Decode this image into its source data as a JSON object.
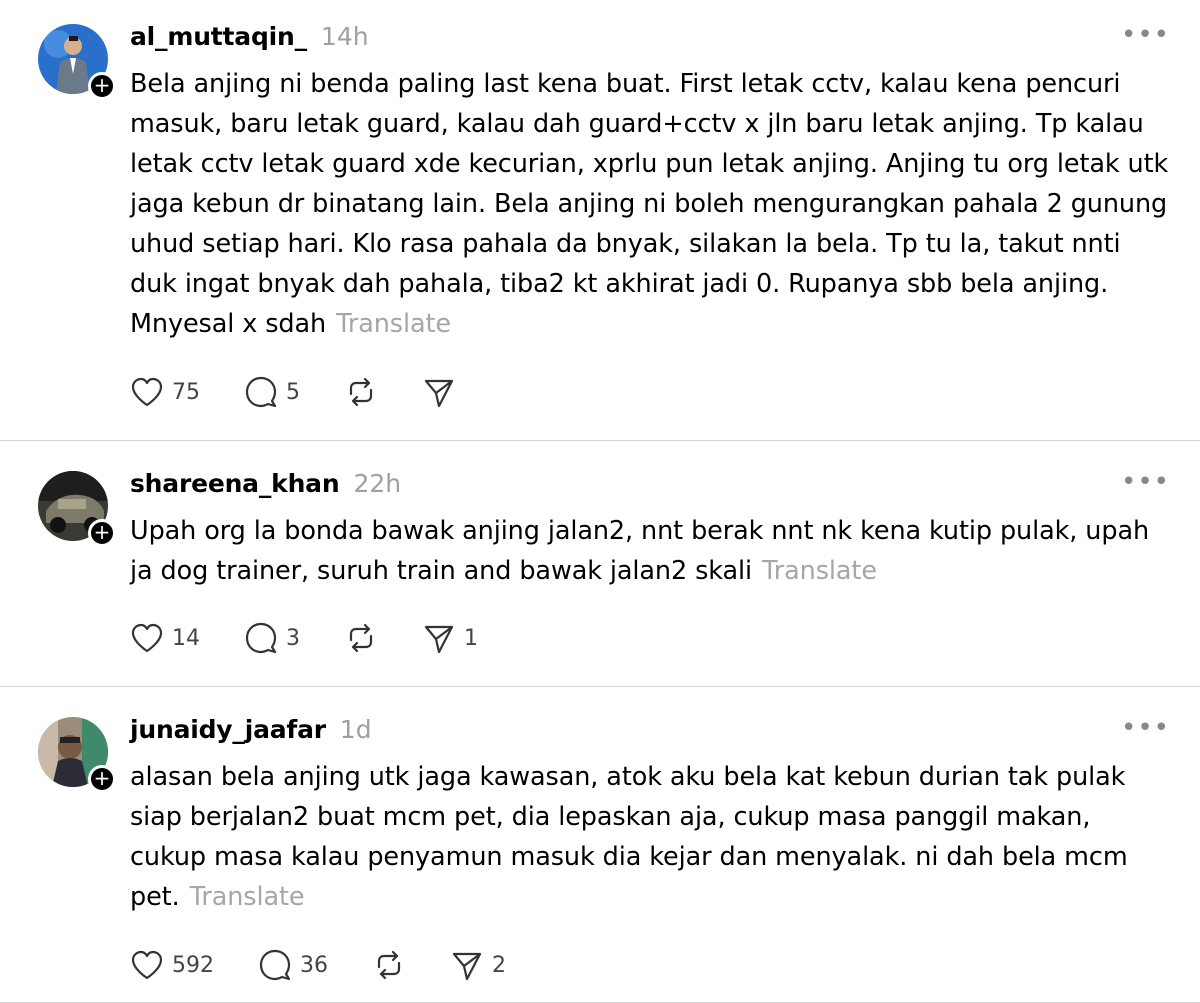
{
  "posts": [
    {
      "username": "al_muttaqin_",
      "time": "14h",
      "text": "Bela anjing ni benda paling last kena buat. First letak cctv, kalau kena pencuri masuk, baru letak guard, kalau dah guard+cctv x jln baru letak anjing. Tp kalau letak cctv letak guard xde kecurian, xprlu pun letak anjing. Anjing tu org letak utk jaga kebun dr binatang lain. Bela anjing ni boleh mengurangkan pahala 2 gunung uhud setiap hari. Klo rasa pahala da bnyak, silakan la bela. Tp tu la, takut nnti duk ingat bnyak dah pahala, tiba2 kt akhirat jadi 0. Rupanya sbb bela anjing. Mnyesal x sdah",
      "translate": "Translate",
      "likes": "75",
      "replies": "5",
      "reposts": "",
      "shares": ""
    },
    {
      "username": "shareena_khan",
      "time": "22h",
      "text": "Upah org la bonda bawak anjing jalan2, nnt berak nnt nk kena kutip pulak, upah ja dog trainer, suruh train and bawak jalan2 skali",
      "translate": "Translate",
      "likes": "14",
      "replies": "3",
      "reposts": "",
      "shares": "1"
    },
    {
      "username": "junaidy_jaafar",
      "time": "1d",
      "text": "alasan bela anjing utk jaga kawasan, atok aku bela kat kebun durian tak pulak siap berjalan2 buat mcm pet, dia lepaskan aja, cukup masa panggil makan, cukup masa kalau penyamun masuk dia kejar dan menyalak. ni dah bela mcm pet.",
      "translate": "Translate",
      "likes": "592",
      "replies": "36",
      "reposts": "",
      "shares": "2"
    }
  ],
  "icons": {
    "more": "more-dots-icon",
    "like": "heart-icon",
    "reply": "comment-icon",
    "repost": "repost-icon",
    "share": "send-icon",
    "follow": "plus-icon"
  }
}
